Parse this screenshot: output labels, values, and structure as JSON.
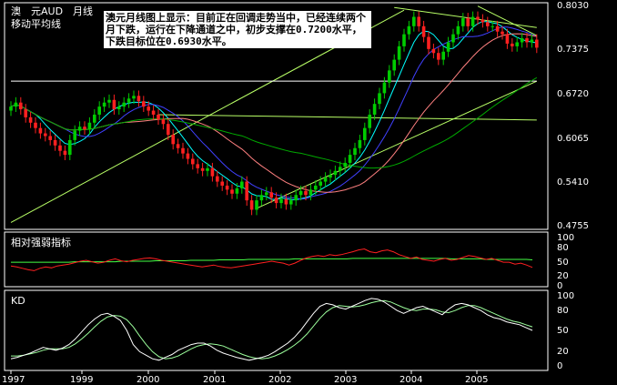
{
  "colors": {
    "background": "#000000",
    "frame": "#ffffff",
    "up": "#00cc00",
    "down": "#ff2020",
    "ma_fast": "#00ffff",
    "ma_mid": "#4040ff",
    "ma_slow": "#ff8080",
    "ma_long": "#00aa00",
    "trend": "#b8ff66",
    "rsi": "#ff2020",
    "rsi_ma": "#44ff44",
    "kd_k": "#ffffff",
    "kd_d": "#9cff9c"
  },
  "header": {
    "title": "澳　元AUD　月线",
    "subtitle": "移动平均线"
  },
  "annotation": "澳元月线图上显示：目前正在回调走势当中，已经连续两个月下跌，运行在下降通道之中，初步支撑在0.7200水平，下跌目标位在0.6930水平。",
  "rsi_panel": {
    "label": "相对强弱指标",
    "ticks": [
      "100",
      "80",
      "50",
      "20",
      "0"
    ]
  },
  "kd_panel": {
    "label": "KD",
    "ticks": [
      "100",
      "80",
      "50",
      "20",
      "0"
    ]
  },
  "chart_data": {
    "type": "candlestick",
    "interval": "monthly",
    "x_ticks": [
      "1997",
      "1999",
      "2000",
      "2001",
      "2002",
      "2003",
      "2004",
      "2005"
    ],
    "y_ticks": [
      "0.8030",
      "0.7375",
      "0.6720",
      "0.6065",
      "0.5410",
      "0.4755"
    ],
    "ylim": [
      0.4755,
      0.803
    ],
    "start": "1997-11",
    "closes": [
      0.652,
      0.658,
      0.648,
      0.636,
      0.628,
      0.62,
      0.612,
      0.608,
      0.602,
      0.594,
      0.586,
      0.58,
      0.602,
      0.616,
      0.622,
      0.618,
      0.628,
      0.64,
      0.652,
      0.658,
      0.662,
      0.648,
      0.652,
      0.658,
      0.664,
      0.668,
      0.66,
      0.652,
      0.646,
      0.64,
      0.633,
      0.626,
      0.61,
      0.596,
      0.59,
      0.582,
      0.574,
      0.566,
      0.56,
      0.556,
      0.56,
      0.548,
      0.54,
      0.534,
      0.528,
      0.522,
      0.53,
      0.54,
      0.512,
      0.498,
      0.512,
      0.52,
      0.524,
      0.516,
      0.508,
      0.514,
      0.506,
      0.512,
      0.52,
      0.526,
      0.52,
      0.528,
      0.534,
      0.54,
      0.546,
      0.55,
      0.556,
      0.562,
      0.568,
      0.58,
      0.59,
      0.602,
      0.62,
      0.64,
      0.656,
      0.672,
      0.688,
      0.706,
      0.722,
      0.742,
      0.76,
      0.772,
      0.786,
      0.772,
      0.756,
      0.738,
      0.732,
      0.722,
      0.734,
      0.748,
      0.76,
      0.772,
      0.784,
      0.772,
      0.786,
      0.782,
      0.778,
      0.772,
      0.772,
      0.764,
      0.76,
      0.746,
      0.742,
      0.748,
      0.754,
      0.748,
      0.752,
      0.74
    ],
    "rsi": [
      38,
      36,
      33,
      30,
      28,
      33,
      36,
      34,
      38,
      40,
      42,
      45,
      48,
      50,
      47,
      44,
      46,
      50,
      53,
      49,
      47,
      50,
      52,
      54,
      55,
      53,
      50,
      48,
      46,
      44,
      42,
      40,
      38,
      36,
      38,
      40,
      37,
      35,
      34,
      36,
      38,
      40,
      42,
      44,
      46,
      48,
      46,
      44,
      40,
      44,
      50,
      55,
      58,
      60,
      58,
      62,
      60,
      62,
      65,
      68,
      72,
      74,
      68,
      66,
      70,
      72,
      68,
      62,
      58,
      54,
      57,
      52,
      50,
      48,
      52,
      54,
      50,
      52,
      56,
      60,
      58,
      55,
      52,
      54,
      50,
      46,
      46,
      42,
      44,
      40,
      35
    ],
    "rsi_ma": [
      46,
      46,
      46,
      46,
      46,
      46,
      46,
      46,
      46,
      46,
      46,
      47,
      47,
      47,
      47,
      47,
      47,
      47,
      47,
      48,
      48,
      48,
      48,
      48,
      48,
      49,
      49,
      49,
      49,
      49,
      49,
      50,
      50,
      50,
      50,
      50,
      51,
      51,
      51,
      51,
      51,
      52,
      52,
      52,
      52,
      52,
      52,
      52,
      52,
      53,
      53,
      53,
      53,
      53,
      53,
      53,
      53,
      53,
      53,
      54,
      54,
      54,
      54,
      54,
      54,
      54,
      54,
      54,
      54,
      54,
      54,
      54,
      54,
      54,
      54,
      54,
      53,
      53,
      53,
      53,
      53,
      53,
      52,
      52,
      52,
      52,
      52,
      52,
      52,
      52,
      51
    ],
    "kd_k": [
      10,
      12,
      15,
      18,
      22,
      26,
      24,
      22,
      25,
      30,
      38,
      48,
      58,
      66,
      72,
      74,
      70,
      64,
      50,
      30,
      20,
      15,
      10,
      8,
      12,
      16,
      22,
      26,
      30,
      32,
      32,
      28,
      22,
      18,
      15,
      12,
      10,
      8,
      10,
      12,
      15,
      20,
      26,
      32,
      40,
      50,
      62,
      74,
      84,
      88,
      86,
      82,
      80,
      84,
      88,
      92,
      95,
      94,
      90,
      84,
      78,
      74,
      78,
      82,
      84,
      80,
      76,
      72,
      80,
      86,
      88,
      86,
      82,
      78,
      72,
      68,
      66,
      62,
      60,
      58,
      54,
      50
    ],
    "kd_d": [
      14,
      14,
      15,
      17,
      19,
      22,
      24,
      24,
      24,
      26,
      31,
      38,
      46,
      55,
      63,
      69,
      71,
      70,
      65,
      55,
      42,
      30,
      20,
      13,
      10,
      11,
      14,
      19,
      24,
      28,
      30,
      31,
      30,
      28,
      24,
      20,
      16,
      13,
      11,
      10,
      11,
      14,
      18,
      23,
      29,
      36,
      45,
      56,
      67,
      76,
      82,
      85,
      84,
      83,
      84,
      86,
      89,
      91,
      92,
      90,
      86,
      82,
      79,
      78,
      80,
      80,
      79,
      76,
      75,
      78,
      82,
      85,
      85,
      82,
      78,
      74,
      70,
      66,
      63,
      61,
      58,
      55
    ]
  }
}
